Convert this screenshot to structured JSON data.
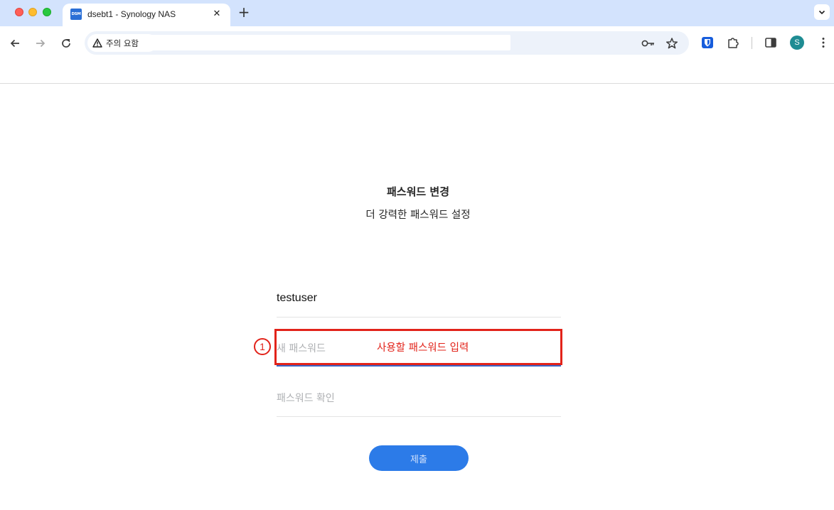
{
  "browser": {
    "tab": {
      "favicon_text": "DSM",
      "title": "dsebt1 - Synology NAS",
      "close_symbol": "✕"
    },
    "new_tab_symbol": "+",
    "security_chip": {
      "icon": "warning-triangle-icon",
      "label": "주의 요함"
    },
    "url": "",
    "profile_initial": "S"
  },
  "page": {
    "heading": "패스워드 변경",
    "subheading": "더 강력한 패스워드 설정",
    "form": {
      "username": "testuser",
      "new_password_placeholder": "새 패스워드",
      "confirm_password_placeholder": "패스워드 확인",
      "submit_label": "제출"
    }
  },
  "annotation": {
    "number": "1",
    "text": "사용할 패스워드 입력",
    "color": "#e2231a"
  },
  "colors": {
    "accent": "#2c7be8",
    "focus_underline": "#3a63c4"
  }
}
